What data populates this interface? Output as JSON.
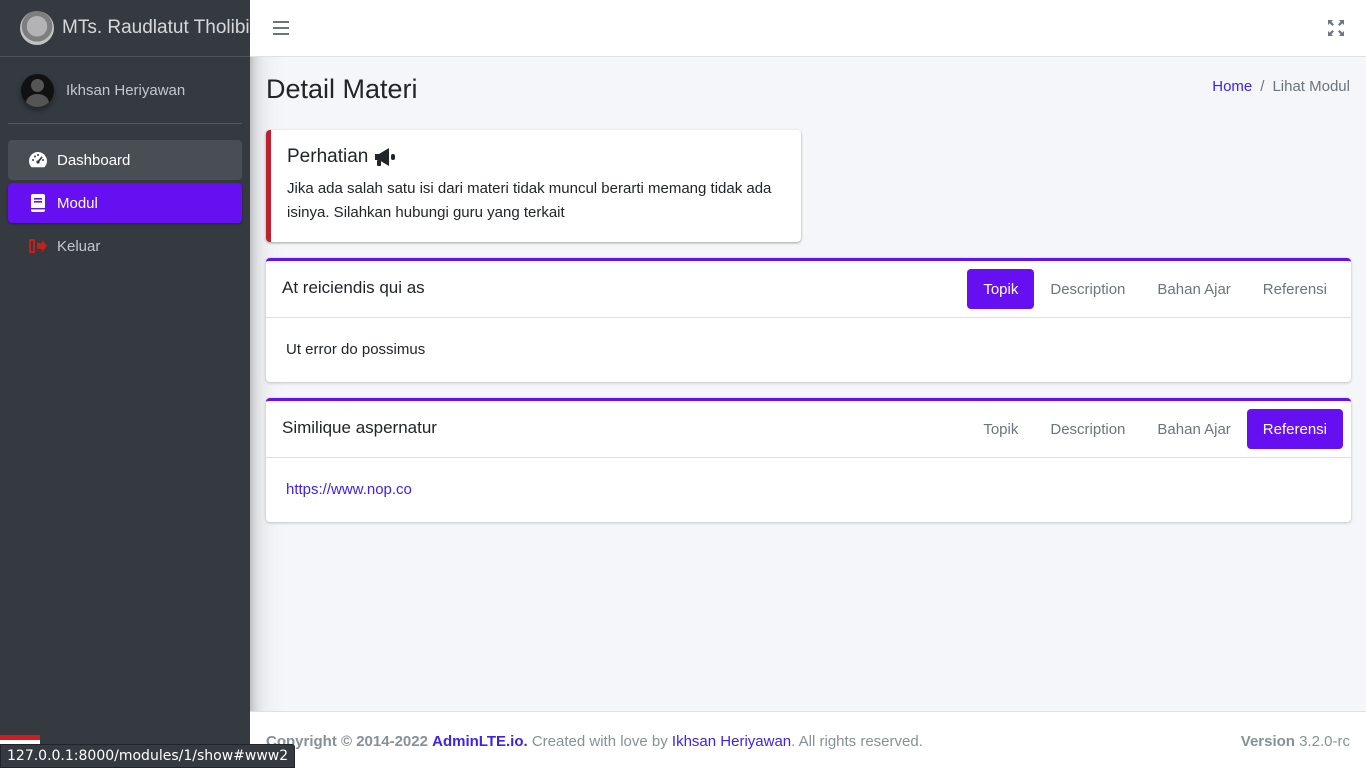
{
  "brand": {
    "name": "MTs. Raudlatut Tholibin"
  },
  "user": {
    "name": "Ikhsan Heriyawan"
  },
  "sidebar": {
    "items": [
      {
        "label": "Dashboard",
        "icon": "tachometer-icon"
      },
      {
        "label": "Modul",
        "icon": "book-icon"
      },
      {
        "label": "Keluar",
        "icon": "sign-out-icon"
      }
    ]
  },
  "page": {
    "title": "Detail Materi"
  },
  "breadcrumb": {
    "home": "Home",
    "current": "Lihat Modul"
  },
  "callout": {
    "title": "Perhatian",
    "text": "Jika ada salah satu isi dari materi tidak muncul berarti memang tidak ada isinya. Silahkan hubungi guru yang terkait"
  },
  "cards": [
    {
      "title": "At reiciendis qui as",
      "tabs": [
        "Topik",
        "Description",
        "Bahan Ajar",
        "Referensi"
      ],
      "active_tab": "Topik",
      "body": "Ut error do possimus"
    },
    {
      "title": "Similique aspernatur",
      "tabs": [
        "Topik",
        "Description",
        "Bahan Ajar",
        "Referensi"
      ],
      "active_tab": "Referensi",
      "body": "https://www.nop.co"
    }
  ],
  "footer": {
    "copyright": "Copyright © 2014-2022",
    "brand_link": "AdminLTE.io.",
    "created_by": "Created with love by",
    "author_link": "Ikhsan Heriyawan",
    "rights": ". All rights reserved.",
    "version_label": "Version",
    "version": "3.2.0-rc"
  },
  "status_bar": {
    "url": "127.0.0.1:8000/modules/1/show#www2"
  },
  "colors": {
    "accent": "#6610f2",
    "sidebar_bg": "#343a40",
    "danger": "#bd2130",
    "link": "#3f22e8"
  }
}
